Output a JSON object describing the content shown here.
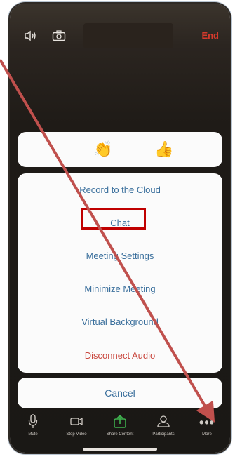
{
  "top_bar": {
    "speaker_icon": "speaker-icon",
    "camera_icon": "camera-switch-icon",
    "end_label": "End"
  },
  "reactions": [
    {
      "icon": "clap-emoji",
      "glyph": "👏"
    },
    {
      "icon": "thumbs-up-emoji",
      "glyph": "👍"
    }
  ],
  "menu": {
    "items": [
      {
        "label": "Record to the Cloud"
      },
      {
        "label": "Chat"
      },
      {
        "label": "Meeting Settings"
      },
      {
        "label": "Minimize Meeting"
      },
      {
        "label": "Virtual Background"
      },
      {
        "label": "Disconnect Audio"
      }
    ],
    "cancel_label": "Cancel"
  },
  "toolbar": {
    "items": [
      {
        "label": "Mute",
        "glyph": "🎙"
      },
      {
        "label": "Stop Video",
        "glyph": "▯"
      },
      {
        "label": "Share Content",
        "glyph": "⇧"
      },
      {
        "label": "Participants",
        "glyph": "👥"
      },
      {
        "label": "More",
        "glyph": "•••"
      }
    ]
  },
  "colors": {
    "menu_text": "#3a6f9c",
    "danger_text": "#c9473e",
    "highlight": "#c00000",
    "arrow": "#c0504d",
    "share_green": "#3fb34f"
  }
}
